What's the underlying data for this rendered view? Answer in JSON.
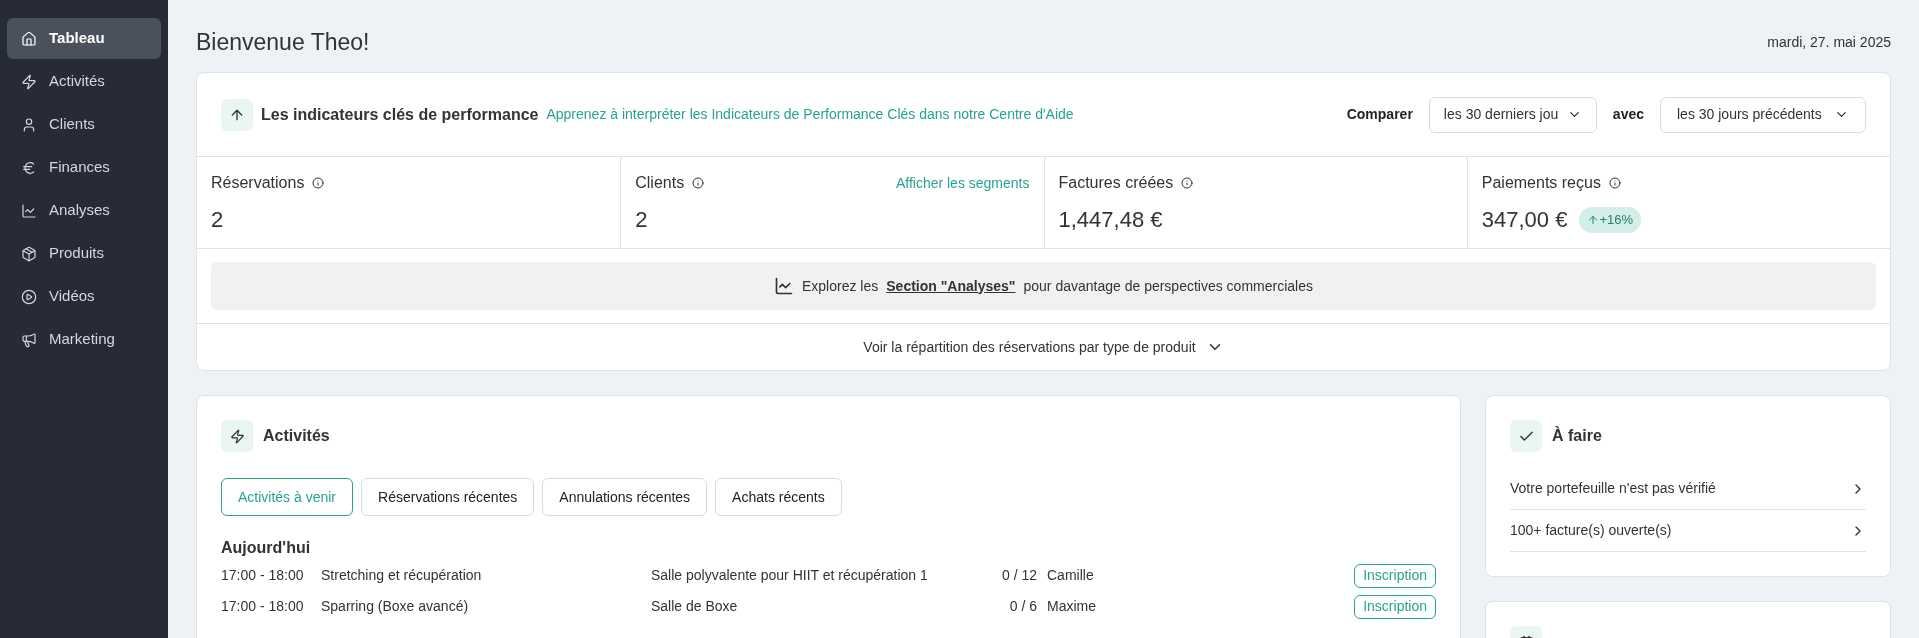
{
  "sidebar": {
    "items": [
      {
        "label": "Tableau",
        "selected": true
      },
      {
        "label": "Activités",
        "selected": false
      },
      {
        "label": "Clients",
        "selected": false
      },
      {
        "label": "Finances",
        "selected": false
      },
      {
        "label": "Analyses",
        "selected": false
      },
      {
        "label": "Produits",
        "selected": false
      },
      {
        "label": "Vidéos",
        "selected": false
      },
      {
        "label": "Marketing",
        "selected": false
      }
    ]
  },
  "header": {
    "greeting": "Bienvenue Theo!",
    "date": "mardi, 27. mai 2025"
  },
  "kpi": {
    "title": "Les indicateurs clés de performance",
    "help_link": "Apprenez à interpréter les Indicateurs de Performance Clés dans notre Centre d'Aide",
    "compare_label": "Comparer",
    "period": "les 30 derniers jou",
    "with_label": "avec",
    "reference": "les 30 jours précédents",
    "metrics": [
      {
        "label": "Réservations",
        "value": "2"
      },
      {
        "label": "Clients",
        "value": "2",
        "link": "Afficher les segments"
      },
      {
        "label": "Factures créées",
        "value": "1,447,48 €"
      },
      {
        "label": "Paiements reçus",
        "value": "347,00 €",
        "badge": "+16%"
      }
    ],
    "explore": {
      "before": "Explorez les",
      "link": "Section \"Analyses\"",
      "after": "pour davantage de perspectives commerciales"
    },
    "breakdown_toggle": "Voir la répartition des réservations par type de produit"
  },
  "activities": {
    "title": "Activités",
    "tabs": [
      {
        "label": "Activités à venir",
        "selected": true
      },
      {
        "label": "Réservations récentes",
        "selected": false
      },
      {
        "label": "Annulations récentes",
        "selected": false
      },
      {
        "label": "Achats récents",
        "selected": false
      }
    ],
    "day": "Aujourd'hui",
    "rows": [
      {
        "time": "17:00 - 18:00",
        "name": "Stretching et récupération",
        "room": "Salle polyvalente pour HIIT et récupération 1",
        "capacity": "0 / 12",
        "coach": "Camille",
        "action": "Inscription"
      },
      {
        "time": "17:00 - 18:00",
        "name": "Sparring (Boxe avancé)",
        "room": "Salle de Boxe",
        "capacity": "0 / 6",
        "coach": "Maxime",
        "action": "Inscription"
      }
    ]
  },
  "todo": {
    "title": "À faire",
    "items": [
      "Votre portefeuille n'est pas vérifié",
      "100+ facture(s) ouverte(s)"
    ]
  }
}
